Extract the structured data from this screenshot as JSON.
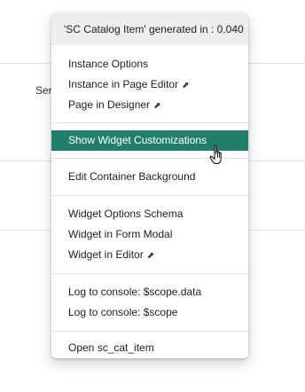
{
  "background": {
    "partial_label": "Ser"
  },
  "menu": {
    "header": "'SC Catalog Item' generated in : 0.040",
    "sections": [
      {
        "items": [
          {
            "label": "Instance Options"
          },
          {
            "label": "Instance in Page Editor",
            "ext": "⬈"
          },
          {
            "label": "Page in Designer",
            "ext": "⬈"
          }
        ]
      },
      {
        "items": [
          {
            "label": "Show Widget Customizations",
            "active": true
          }
        ]
      },
      {
        "items": [
          {
            "label": "Edit Container Background"
          }
        ]
      },
      {
        "items": [
          {
            "label": "Widget Options Schema"
          },
          {
            "label": "Widget in Form Modal"
          },
          {
            "label": "Widget in Editor",
            "ext": "⬈"
          }
        ]
      },
      {
        "items": [
          {
            "label": "Log to console: $scope.data"
          },
          {
            "label": "Log to console: $scope"
          }
        ]
      },
      {
        "items": [
          {
            "label": "Open sc_cat_item"
          }
        ]
      }
    ]
  },
  "colors": {
    "active_bg": "#217e6b",
    "header_bg": "#eeeeee"
  },
  "icons": {
    "cursor": "hand-pointer-icon",
    "external": "external-link-icon"
  }
}
